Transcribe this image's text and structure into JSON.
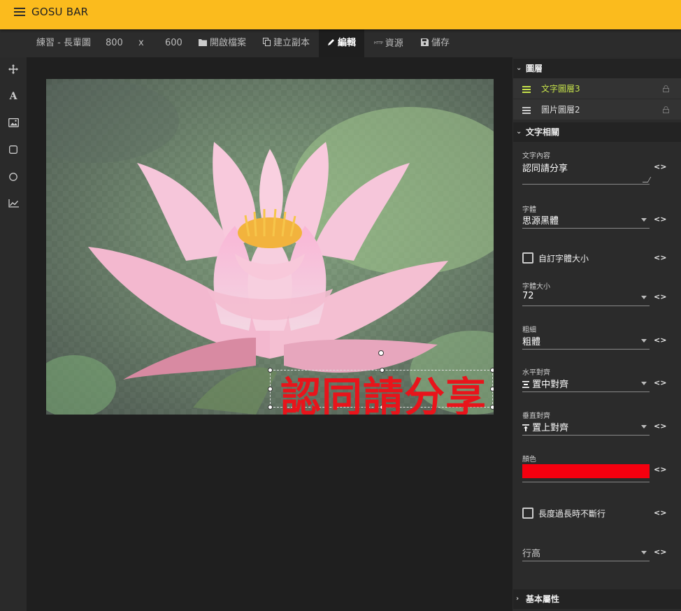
{
  "app": {
    "title": "GOSU BAR"
  },
  "toolbar": {
    "project_name": "練習 - 長輩圖",
    "width": "800",
    "times": "x",
    "height": "600",
    "open_label": "開啟檔案",
    "duplicate_label": "建立副本",
    "edit_label": "編輯",
    "resources_label": "資源",
    "save_label": "儲存"
  },
  "tools": [
    "move-icon",
    "text-icon",
    "image-icon",
    "rectangle-icon",
    "circle-icon",
    "chart-icon"
  ],
  "canvas": {
    "text_content": "認同請分享",
    "text_color": "#e8141b"
  },
  "layers_panel": {
    "title": "圖層",
    "layers": [
      {
        "name": "文字圖層3",
        "active": true
      },
      {
        "name": "圖片圖層2",
        "active": false
      }
    ]
  },
  "text_props": {
    "title": "文字相關",
    "content_label": "文字內容",
    "content_value": "認同請分享",
    "font_label": "字體",
    "font_value": "思源黑體",
    "custom_size_label": "自訂字體大小",
    "size_label": "字體大小",
    "size_value": "72",
    "weight_label": "粗細",
    "weight_value": "粗體",
    "halign_label": "水平對齊",
    "halign_value": "置中對齊",
    "valign_label": "垂直對齊",
    "valign_value": "置上對齊",
    "color_label": "顏色",
    "color_value": "#f5000f",
    "nowrap_label": "長度過長時不斷行",
    "line_height_placeholder": "行高"
  },
  "basic_props": {
    "title": "基本屬性"
  },
  "colors": {
    "appbar": "#fbbb1d",
    "active_layer": "#c6e24b"
  }
}
